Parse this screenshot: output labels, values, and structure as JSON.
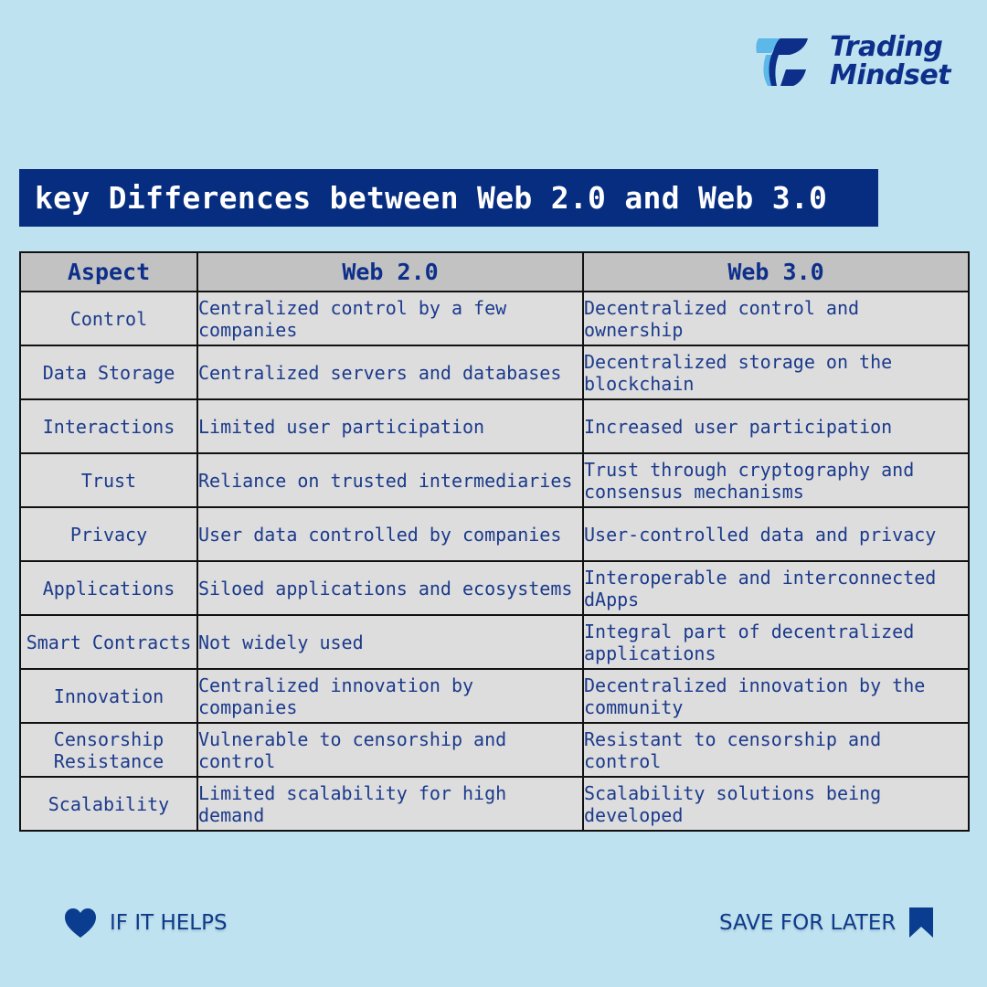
{
  "brand": {
    "name_line1": "Trading",
    "name_line2": "Mindset",
    "logo_icon": "trading-mindset-t-logo",
    "colors": {
      "dark": "#0d2f8a",
      "light": "#5bb8e8"
    }
  },
  "title": "key Differences between Web 2.0 and Web 3.0",
  "table": {
    "headers": [
      "Aspect",
      "Web 2.0",
      "Web 3.0"
    ],
    "rows": [
      {
        "aspect": "Control",
        "web2": "Centralized control by a few companies",
        "web3": "Decentralized control and ownership"
      },
      {
        "aspect": "Data Storage",
        "web2": "Centralized servers and databases",
        "web3": "Decentralized storage on the blockchain"
      },
      {
        "aspect": "Interactions",
        "web2": "Limited user participation",
        "web3": "Increased user participation"
      },
      {
        "aspect": "Trust",
        "web2": "Reliance on trusted intermediaries",
        "web3": "Trust through cryptography and consensus mechanisms"
      },
      {
        "aspect": "Privacy",
        "web2": "User data controlled by companies",
        "web3": "User-controlled data and privacy"
      },
      {
        "aspect": "Applications",
        "web2": "Siloed applications and ecosystems",
        "web3": "Interoperable and interconnected dApps"
      },
      {
        "aspect": "Smart Contracts",
        "web2": "Not widely used",
        "web3": "Integral part of decentralized applications"
      },
      {
        "aspect": "Innovation",
        "web2": "Centralized innovation by companies",
        "web3": "Decentralized innovation by the community"
      },
      {
        "aspect": "Censorship Resistance",
        "web2": "Vulnerable to censorship and control",
        "web3": "Resistant to censorship and control"
      },
      {
        "aspect": "Scalability",
        "web2": "Limited scalability for high demand",
        "web3": "Scalability solutions being developed"
      }
    ]
  },
  "footer": {
    "left_label": "IF IT HELPS",
    "left_icon": "heart-icon",
    "right_label": "SAVE FOR LATER",
    "right_icon": "bookmark-icon"
  },
  "colors": {
    "background": "#bfe2f0",
    "title_bar": "#062d80",
    "text_dark_blue": "#0d2f8a",
    "header_cell": "#c2c2c2",
    "body_cell": "#dddddd"
  }
}
